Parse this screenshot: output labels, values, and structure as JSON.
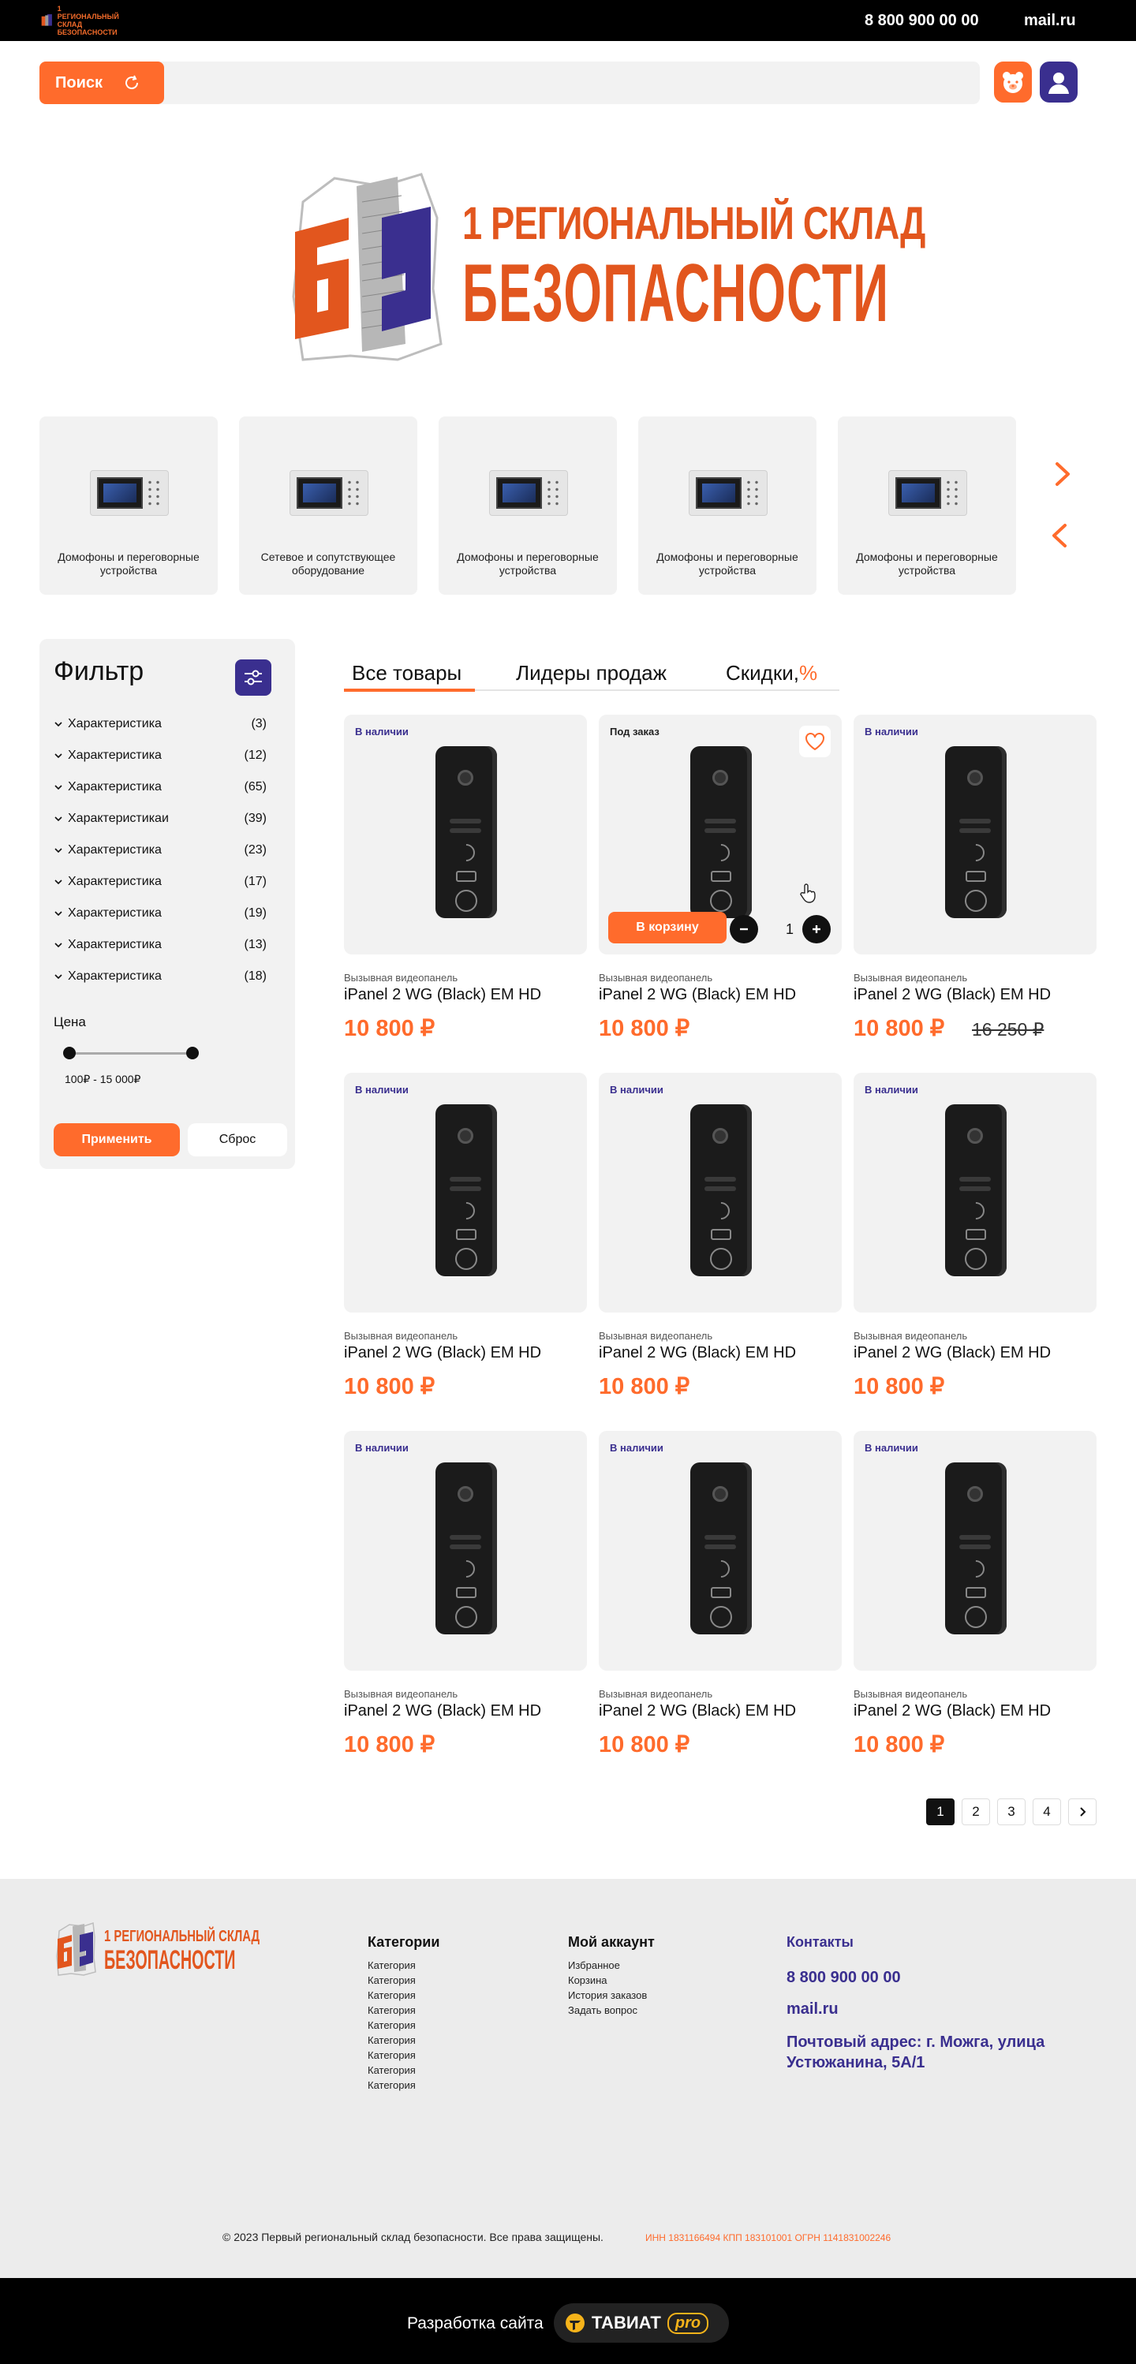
{
  "header": {
    "logo_line1": "1 РЕГИОНАЛЬНЫЙ СКЛАД",
    "logo_line2": "БЕЗОПАСНОСТИ",
    "phone": "8 800 900 00 00",
    "email": "mail.ru"
  },
  "search": {
    "button_label": "Поиск",
    "placeholder": ""
  },
  "brand": {
    "line1": "1 РЕГИОНАЛЬНЫЙ СКЛАД",
    "line2": "БЕЗОПАСНОСТИ",
    "colors": {
      "orange": "#e2561e",
      "indigo": "#3a2f8f"
    }
  },
  "categories": [
    {
      "label": "Домофоны и переговорные устройства"
    },
    {
      "label": "Сетевое и сопутствующее оборудование"
    },
    {
      "label": "Домофоны и переговорные устройства"
    },
    {
      "label": "Домофоны и переговорные устройства"
    },
    {
      "label": "Домофоны и переговорные устройства"
    }
  ],
  "filter": {
    "title": "Фильтр",
    "rows": [
      {
        "label": "Характеристика",
        "count": "(3)"
      },
      {
        "label": "Характеристика",
        "count": "(12)"
      },
      {
        "label": "Характеристика",
        "count": "(65)"
      },
      {
        "label": "Характеристикаи",
        "count": "(39)"
      },
      {
        "label": "Характеристика",
        "count": "(23)"
      },
      {
        "label": "Характеристика",
        "count": "(17)"
      },
      {
        "label": "Характеристика",
        "count": "(19)"
      },
      {
        "label": "Характеристика",
        "count": "(13)"
      },
      {
        "label": "Характеристика",
        "count": "(18)"
      }
    ],
    "price_label": "Цена",
    "price_range": "100₽ - 15 000₽",
    "apply_label": "Применить",
    "reset_label": "Сброс"
  },
  "tabs": [
    {
      "label": "Все товары"
    },
    {
      "label": "Лидеры продаж"
    },
    {
      "label": "Скидки,",
      "suffix": "%"
    }
  ],
  "products": [
    {
      "badge": "В наличии",
      "type": "Вызывная видеопанель",
      "name": "iPanel 2 WG (Black) EM HD",
      "price": "10 800 ₽"
    },
    {
      "badge": "Под заказ",
      "type": "Вызывная видеопанель",
      "name": "iPanel 2 WG (Black) EM HD",
      "price": "10 800 ₽",
      "cart_label": "В корзину",
      "qty": "1"
    },
    {
      "badge": "В наличии",
      "type": "Вызывная видеопанель",
      "name": "iPanel 2 WG (Black) EM HD",
      "price": "10 800 ₽",
      "old_price": "16 250 ₽"
    },
    {
      "badge": "В наличии",
      "type": "Вызывная видеопанель",
      "name": "iPanel 2 WG (Black) EM HD",
      "price": "10 800 ₽"
    },
    {
      "badge": "В наличии",
      "type": "Вызывная видеопанель",
      "name": "iPanel 2 WG (Black) EM HD",
      "price": "10 800 ₽"
    },
    {
      "badge": "В наличии",
      "type": "Вызывная видеопанель",
      "name": "iPanel 2 WG (Black) EM HD",
      "price": "10 800 ₽"
    },
    {
      "badge": "В наличии",
      "type": "Вызывная видеопанель",
      "name": "iPanel 2 WG (Black) EM HD",
      "price": "10 800 ₽"
    },
    {
      "badge": "В наличии",
      "type": "Вызывная видеопанель",
      "name": "iPanel 2 WG (Black) EM HD",
      "price": "10 800 ₽"
    },
    {
      "badge": "В наличии",
      "type": "Вызывная видеопанель",
      "name": "iPanel 2 WG (Black) EM HD",
      "price": "10 800 ₽"
    }
  ],
  "pagination": [
    "1",
    "2",
    "3",
    "4"
  ],
  "footer": {
    "logo_line1": "1 РЕГИОНАЛЬНЫЙ СКЛАД",
    "logo_line2": "БЕЗОПАСНОСТИ",
    "categories_title": "Категории",
    "categories": [
      "Категория",
      "Категория",
      "Категория",
      "Категория",
      "Категория",
      "Категория",
      "Категория",
      "Категория",
      "Категория"
    ],
    "account_title": "Мой аккаунт",
    "account_links": [
      "Избранное",
      "Корзина",
      "История заказов",
      "Задать вопрос"
    ],
    "contacts_title": "Контакты",
    "phone": "8 800 900 00 00",
    "email": "mail.ru",
    "address": "Почтовый адрес:  г. Можга, улица Устюжанина, 5А/1",
    "copyright": "© 2023 Первый региональный склад безопасности. Все права защищены.",
    "legal": "ИНН 1831166494 КПП 183101001 ОГРН 1141831002246",
    "dev_label": "Разработка сайта",
    "dev_brand": "ТАВИАТ",
    "dev_pro": "pro"
  }
}
